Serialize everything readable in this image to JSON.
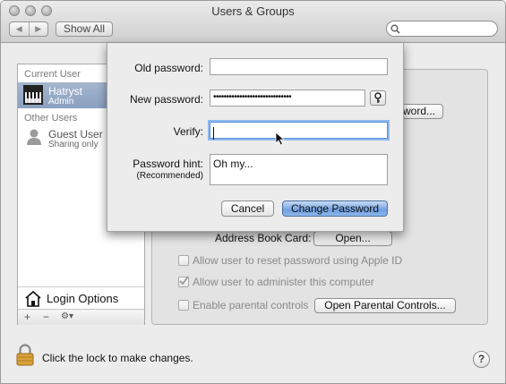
{
  "window": {
    "title": "Users & Groups"
  },
  "toolbar": {
    "back_glyph": "◀",
    "forward_glyph": "▶",
    "show_all": "Show All",
    "search_placeholder": ""
  },
  "sidebar": {
    "current_user_header": "Current User",
    "current_user": {
      "name": "Hatryst",
      "role": "Admin"
    },
    "other_users_header": "Other Users",
    "guest": {
      "name": "Guest User",
      "role": "Sharing only"
    },
    "login_options": "Login Options",
    "tools": {
      "add": "+",
      "remove": "−",
      "action": "⚙▾"
    }
  },
  "main": {
    "change_password_partial": "word...",
    "address_book_label": "Address Book Card:",
    "address_book_button": "Open...",
    "checkboxes": [
      {
        "label": "Allow user to reset password using Apple ID",
        "checked": false
      },
      {
        "label": "Allow user to administer this computer",
        "checked": true
      },
      {
        "label": "Enable parental controls",
        "checked": false
      }
    ],
    "parental_controls_button": "Open Parental Controls..."
  },
  "footer": {
    "lock_message": "Click the lock to make changes.",
    "help": "?"
  },
  "sheet": {
    "old_password_label": "Old password:",
    "old_password_value": "",
    "new_password_label": "New password:",
    "new_password_value": "••••••••••••••••••••••••••••••",
    "verify_label": "Verify:",
    "verify_value": "",
    "hint_label": "Password hint:",
    "hint_sublabel": "(Recommended)",
    "hint_value": "Oh my...",
    "cancel": "Cancel",
    "change_password": "Change Password"
  },
  "colors": {
    "accent": "#6f9fe0",
    "selection": "#8aa0c0",
    "focus_ring": "#8fb9ee"
  }
}
